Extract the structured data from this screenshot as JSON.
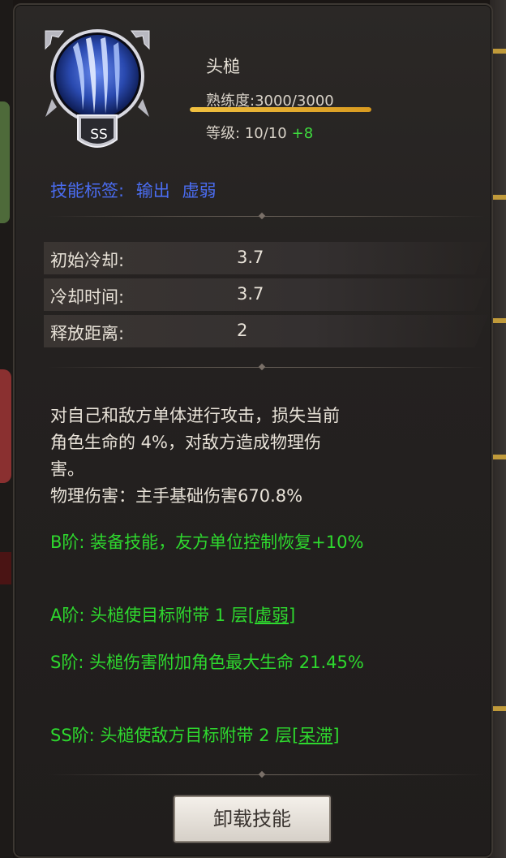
{
  "skill": {
    "grade": "SS",
    "name": "头槌",
    "proficiency_text": "熟练度:3000/3000",
    "proficiency_fraction": 1.0,
    "level_text": "等级: 10/10",
    "level_bonus": "+8"
  },
  "tags": {
    "label": "技能标签:",
    "items": [
      "输出",
      "虚弱"
    ]
  },
  "stats": [
    {
      "label": "初始冷却:",
      "value": "3.7"
    },
    {
      "label": "冷却时间:",
      "value": "3.7"
    },
    {
      "label": "释放距离:",
      "value": "2"
    }
  ],
  "description": {
    "line1": "对自己和敌方单体进行攻击，损失当前",
    "line2": "角色生命的 4%，对敌方造成物理伤",
    "line3": "害。",
    "line4": "物理伤害：主手基础伤害670.8%"
  },
  "tiers": {
    "b": "B阶: 装备技能，友方单位控制恢复+10%",
    "a_prefix": "A阶: 头槌使目标附带 1 层[",
    "a_link": "虚弱",
    "a_suffix": "]",
    "s": "S阶: 头槌伤害附加角色最大生命 21.45%",
    "ss_prefix": "SS阶: 头槌使敌方目标附带 2 层[",
    "ss_link": "呆滞",
    "ss_suffix": "]"
  },
  "buttons": {
    "unload": "卸载技能"
  },
  "colors": {
    "tag_blue": "#4a6cf0",
    "tier_green": "#2ed82e",
    "bonus_green": "#3edc3e",
    "proficiency_gold": "#f0c040"
  },
  "icons": {
    "skill_emblem": "blue-claw-orb-emblem"
  }
}
